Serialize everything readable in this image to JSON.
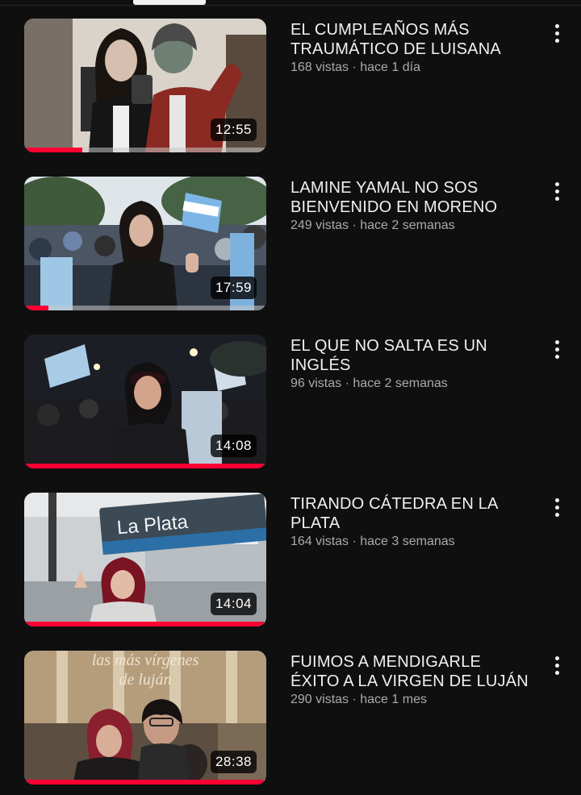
{
  "videos": [
    {
      "title": "EL CUMPLEAÑOS MÁS TRAUMÁTICO DE LUISANA",
      "stats": "168 vistas · hace 1 día",
      "duration": "12:55",
      "watched_fraction": 0.24,
      "thumb_palette": {
        "bg": "#d8d2c8",
        "accent": "#6a1a1a",
        "figure": "#1a1a1a"
      }
    },
    {
      "title": "LAMINE YAMAL NO SOS BIENVENIDO EN MORENO",
      "stats": "249 vistas · hace 2 semanas",
      "duration": "17:59",
      "watched_fraction": 0.1,
      "thumb_palette": {
        "bg": "#bfd0dc",
        "accent": "#74aee0",
        "figure": "#1c1c1c"
      }
    },
    {
      "title": "EL QUE NO SALTA ES UN INGLÉS",
      "stats": "96 vistas · hace 2 semanas",
      "duration": "14:08",
      "watched_fraction": 0.99,
      "thumb_palette": {
        "bg": "#14161c",
        "accent": "#9ec7e6",
        "figure": "#2a2a2a"
      }
    },
    {
      "title": "TIRANDO CÁTEDRA EN LA PLATA",
      "stats": "164 vistas · hace 3 semanas",
      "duration": "14:04",
      "watched_fraction": 0.99,
      "sign_text": "La Plata",
      "thumb_palette": {
        "bg": "#cfd3d6",
        "accent": "#2b6fa6",
        "figure": "#2a2a2a"
      }
    },
    {
      "title": "FUIMOS A MENDIGARLE ÉXITO A LA VIRGEN DE LUJÁN",
      "stats": "290 vistas · hace 1 mes",
      "duration": "28:38",
      "watched_fraction": 0.99,
      "overlay_text": "las más vírgenes de luján",
      "thumb_palette": {
        "bg": "#a8906e",
        "accent": "#e9d9bd",
        "figure": "#1f1f1f"
      }
    }
  ],
  "icons": {
    "more": "more-vert-icon"
  }
}
